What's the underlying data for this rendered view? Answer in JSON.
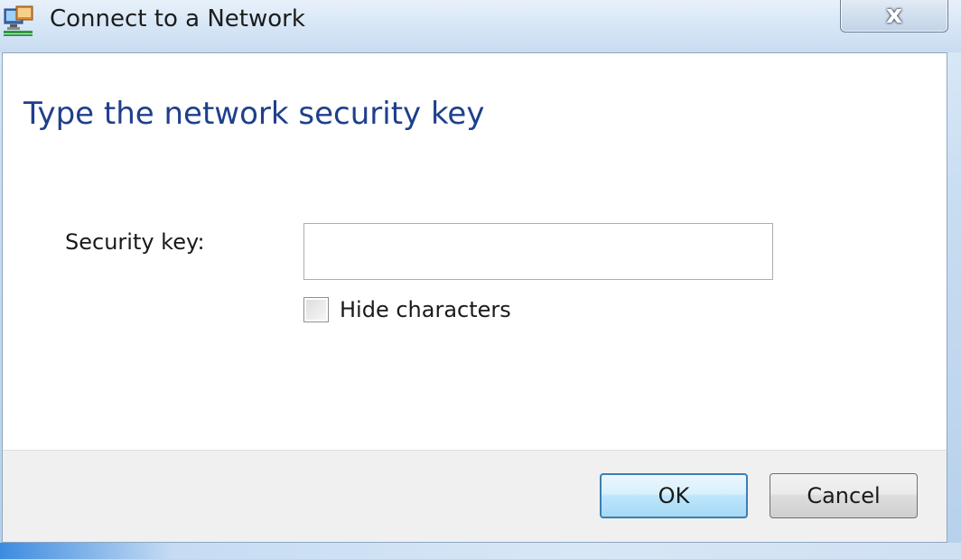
{
  "window": {
    "title": "Connect to a Network",
    "close_label": "x"
  },
  "content": {
    "heading": "Type the network security key",
    "security_key": {
      "label": "Security key:",
      "value": "",
      "placeholder": ""
    },
    "hide_characters": {
      "label": "Hide characters",
      "checked": false
    }
  },
  "footer": {
    "ok_label": "OK",
    "cancel_label": "Cancel"
  },
  "icons": {
    "title_icon": "network-connection-icon"
  },
  "colors": {
    "heading": "#1f3f8b",
    "ok_border": "#3c7fb1"
  }
}
